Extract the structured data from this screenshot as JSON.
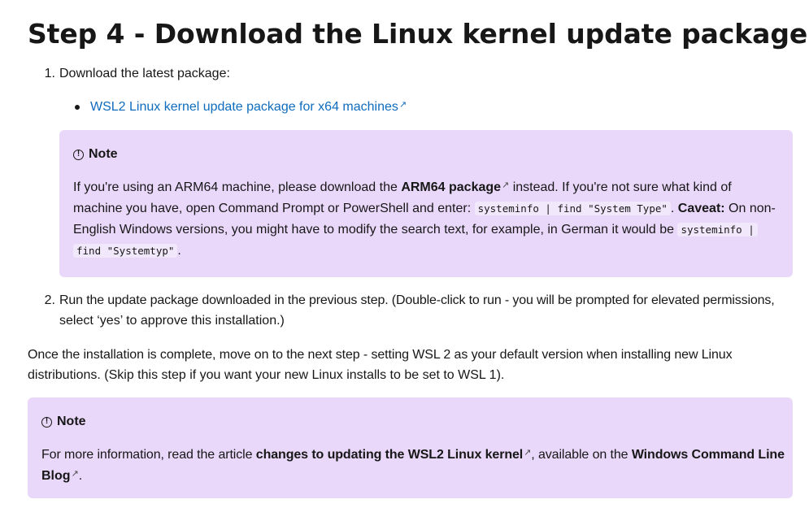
{
  "heading": "Step 4 - Download the Linux kernel update package",
  "steps": [
    {
      "number": "1.",
      "text": "Download the latest package:",
      "link": "WSL2 Linux kernel update package for x64 machines"
    },
    {
      "number": "2.",
      "line1": "Run the update package downloaded in the previous step. (Double-click to run - you will be prompted for elevated permissions,",
      "line2": "select ‘yes’ to approve this installation.)"
    }
  ],
  "note1": {
    "label": "Note",
    "l1_pre": "If you're using an ARM64 machine, please download the ",
    "l1_bold": "ARM64 package",
    "l1_post": " instead. If you're not sure what kind of",
    "l2_pre": "machine you have, open Command Prompt or PowerShell and enter: ",
    "l2_code": "systeminfo | find \"System Type\"",
    "l2_mid": ". ",
    "l2_bold": "Caveat:",
    "l2_post": " On non-",
    "l3_pre": "English Windows versions, you might have to modify the search text, for example, in German it would be ",
    "l3_code": "systeminfo |",
    "l4_code": "find \"Systemtyp\"",
    "l4_post": "."
  },
  "paragraph": {
    "line1": "Once the installation is complete, move on to the next step - setting WSL 2 as your default version when installing new Linux",
    "line2": "distributions. (Skip this step if you want your new Linux installs to be set to WSL 1)."
  },
  "note2": {
    "label": "Note",
    "l1_pre": "For more information, read the article ",
    "l1_bold": "changes to updating the WSL2 Linux kernel",
    "l1_mid": ", available on the ",
    "l1_bold2": "Windows Command Line",
    "l2_bold": "Blog",
    "l2_post": "."
  },
  "icons": {
    "external": "external-link-icon",
    "info": "info-icon"
  }
}
